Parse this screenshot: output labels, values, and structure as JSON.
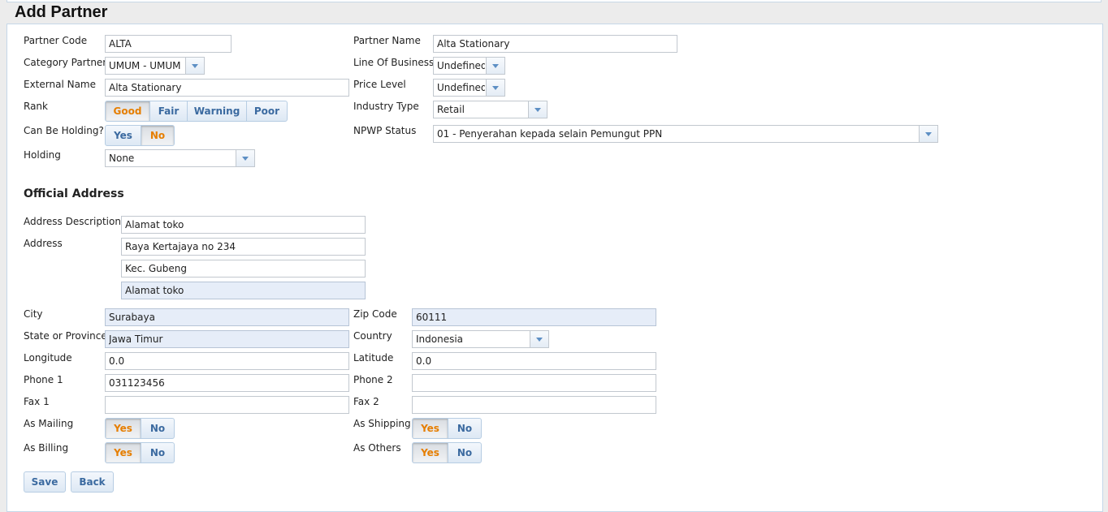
{
  "page": {
    "title": "Add Partner"
  },
  "partner": {
    "code_label": "Partner Code",
    "code_value": "ALTA",
    "name_label": "Partner Name",
    "name_value": "Alta Stationary",
    "category_label": "Category Partner",
    "category_value": "UMUM - UMUM",
    "lob_label": "Line Of Business",
    "lob_value": "Undefined",
    "external_label": "External Name",
    "external_value": "Alta Stationary",
    "price_label": "Price Level",
    "price_value": "Undefined",
    "rank_label": "Rank",
    "rank_options": [
      "Good",
      "Fair",
      "Warning",
      "Poor"
    ],
    "rank_selected": "Good",
    "industry_label": "Industry Type",
    "industry_value": "Retail",
    "holding_q_label": "Can Be Holding?",
    "holding_q_options": [
      "Yes",
      "No"
    ],
    "holding_q_selected": "No",
    "npwp_label": "NPWP Status",
    "npwp_value": "01 - Penyerahan kepada selain Pemungut PPN",
    "holding_label": "Holding",
    "holding_value": "None"
  },
  "address": {
    "section_title": "Official Address",
    "desc_label": "Address Description",
    "desc_value": "Alamat toko",
    "address_label": "Address",
    "line1": "Raya Kertajaya no 234",
    "line2": "Kec. Gubeng",
    "line3": "Alamat toko",
    "city_label": "City",
    "city_value": "Surabaya",
    "zip_label": "Zip Code",
    "zip_value": "60111",
    "state_label": "State or Province",
    "state_value": "Jawa Timur",
    "country_label": "Country",
    "country_value": "Indonesia",
    "lon_label": "Longitude",
    "lon_value": "0.0",
    "lat_label": "Latitude",
    "lat_value": "0.0",
    "phone1_label": "Phone 1",
    "phone1_value": "031123456",
    "phone2_label": "Phone 2",
    "phone2_value": "",
    "fax1_label": "Fax 1",
    "fax1_value": "",
    "fax2_label": "Fax 2",
    "fax2_value": "",
    "mailing_label": "As Mailing",
    "shipping_label": "As Shipping",
    "billing_label": "As Billing",
    "others_label": "As Others",
    "yes": "Yes",
    "no": "No"
  },
  "actions": {
    "save": "Save",
    "back": "Back"
  },
  "colors": {
    "accent": "#3b6aa0",
    "active": "#e67e00",
    "readonly_bg": "#e6edf8"
  }
}
